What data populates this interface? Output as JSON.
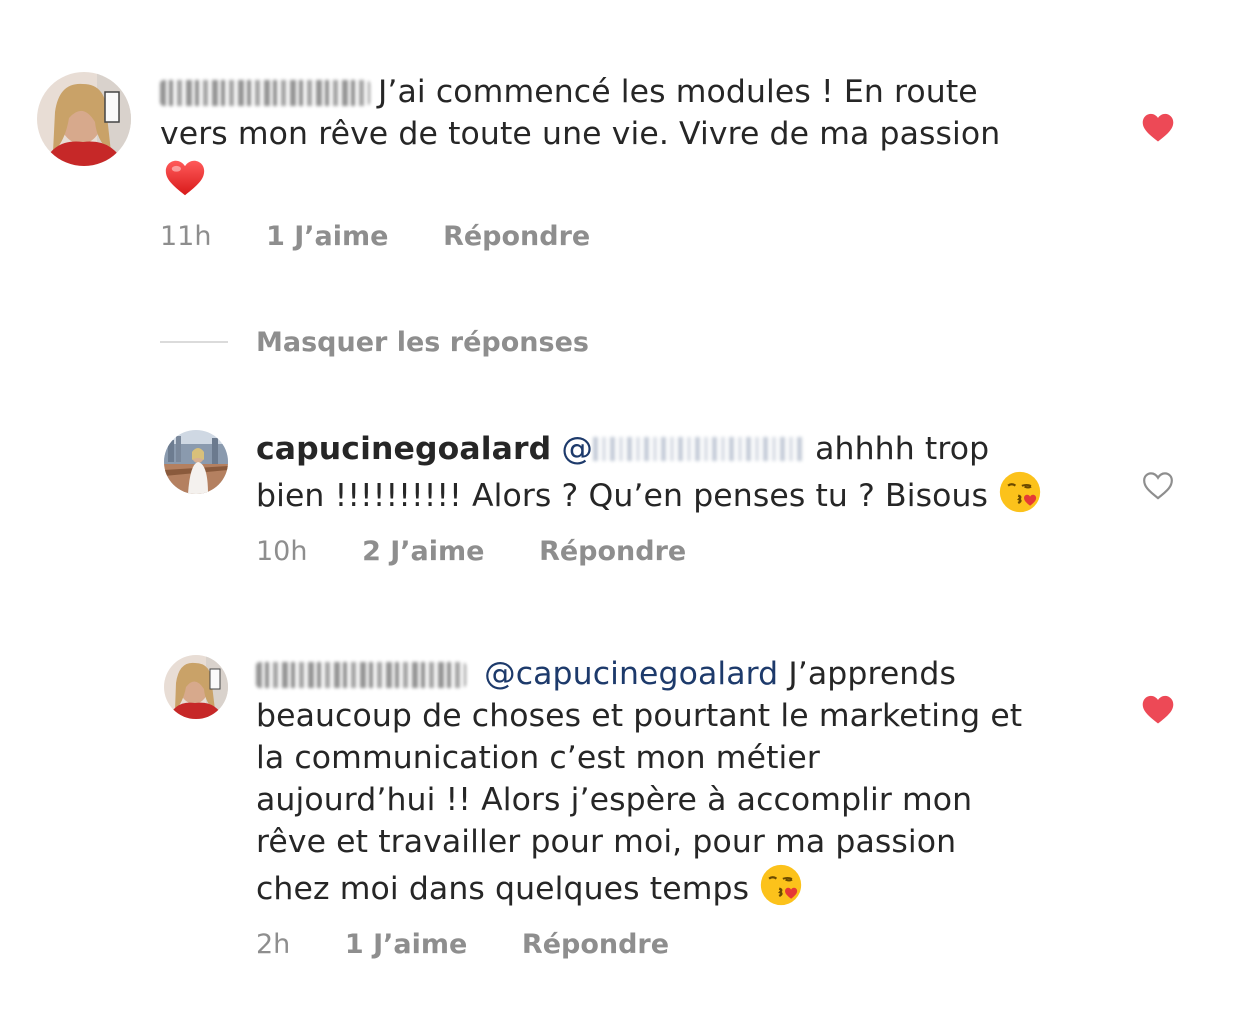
{
  "comments": [
    {
      "username": "mathildeprv",
      "text_line1": "J’ai commencé les modules ! En route",
      "text_line2": "vers mon rêve de toute une vie. Vivre de ma passion",
      "emoji": "red-heart-emoji",
      "time": "11h",
      "likes": "1 J’aime",
      "reply": "Répondre",
      "liked": true
    },
    {
      "username": "capucinegoalard",
      "mention_prefix": "@",
      "mention": "mathildeprv",
      "text_line1": "ahhhh trop",
      "text_line2": "bien !!!!!!!!!! Alors ? Qu’en penses tu ? Bisous",
      "emoji": "face-blowing-kiss-emoji",
      "time": "10h",
      "likes": "2 J’aime",
      "reply": "Répondre",
      "liked": false
    },
    {
      "username": "mathildeprv",
      "mention": "@capucinegoalard",
      "text_line1": "J’apprends",
      "text_line2": "beaucoup de choses et pourtant le marketing et",
      "text_line3": "la communication c’est mon métier",
      "text_line4": "aujourd’hui !! Alors j’espère à accomplir mon",
      "text_line5": "rêve et travailler pour moi, pour ma passion",
      "text_line6": "chez moi dans quelques temps",
      "emoji": "face-blowing-kiss-emoji",
      "time": "2h",
      "likes": "1 J’aime",
      "reply": "Répondre",
      "liked": true
    }
  ],
  "hide_replies_label": "Masquer les réponses",
  "colors": {
    "heart_filled": "#ed4956",
    "meta_gray": "#8e8e8e",
    "mention_blue": "#1d3a6b",
    "text": "#262626"
  }
}
